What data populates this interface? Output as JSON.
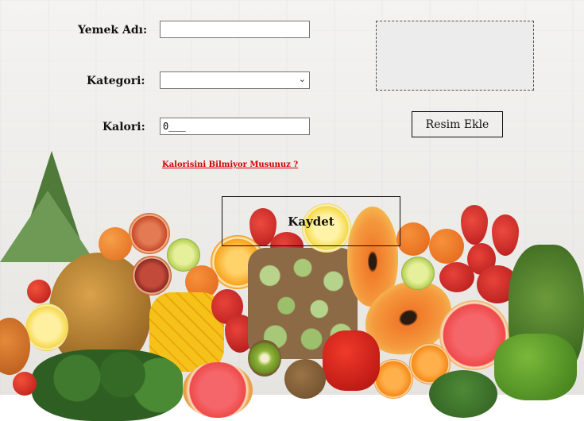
{
  "form": {
    "name_label": "Yemek Adı:",
    "name_value": "",
    "category_label": "Kategori:",
    "category_value": "",
    "calorie_label": "Kalori:",
    "calorie_value": "0___",
    "calorie_help_link": "Kalorisini Bilmiyor Musunuz ?",
    "save_button": "Kaydet"
  },
  "image": {
    "add_button": "Resim Ekle"
  },
  "colors": {
    "link": "#d00000",
    "background": "#f2f1ee"
  }
}
